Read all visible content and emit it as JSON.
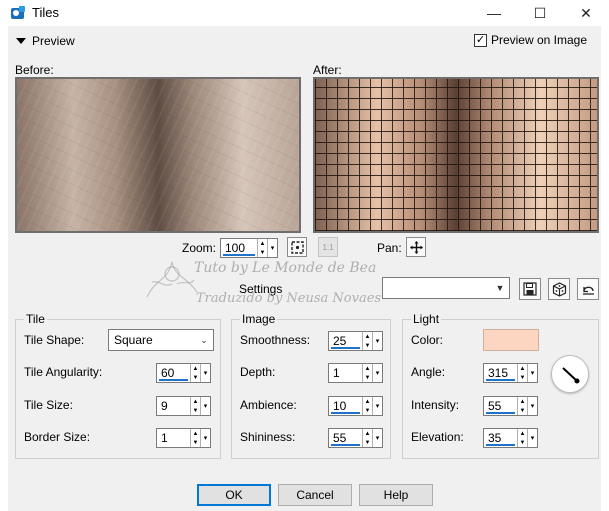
{
  "window": {
    "title": "Tiles",
    "app_icon": "psp-icon"
  },
  "titlebar_buttons": {
    "minimize": "—",
    "maximize": "☐",
    "close": "✕"
  },
  "preview": {
    "toggle_label": "Preview",
    "preview_on_image_label": "Preview on Image",
    "preview_on_image_checked": true
  },
  "before_label": "Before:",
  "after_label": "After:",
  "zoom": {
    "label": "Zoom:",
    "value": "100"
  },
  "pan": {
    "label": "Pan:"
  },
  "settings": {
    "label": "Settings",
    "preset_value": ""
  },
  "watermark": {
    "line1": "Tuto by Le Monde de Bea",
    "line2": "Traduzido by Neusa Novaes"
  },
  "tile": {
    "title": "Tile",
    "shape_label": "Tile Shape:",
    "shape_value": "Square",
    "angularity_label": "Tile Angularity:",
    "angularity_value": "60",
    "size_label": "Tile Size:",
    "size_value": "9",
    "border_label": "Border Size:",
    "border_value": "1"
  },
  "image": {
    "title": "Image",
    "smoothness_label": "Smoothness:",
    "smoothness_value": "25",
    "depth_label": "Depth:",
    "depth_value": "1",
    "ambience_label": "Ambience:",
    "ambience_value": "10",
    "shininess_label": "Shininess:",
    "shininess_value": "55"
  },
  "light": {
    "title": "Light",
    "color_label": "Color:",
    "color_value": "#fdd6c2",
    "angle_label": "Angle:",
    "angle_value": "315",
    "intensity_label": "Intensity:",
    "intensity_value": "55",
    "elevation_label": "Elevation:",
    "elevation_value": "35"
  },
  "buttons": {
    "ok": "OK",
    "cancel": "Cancel",
    "help": "Help"
  }
}
